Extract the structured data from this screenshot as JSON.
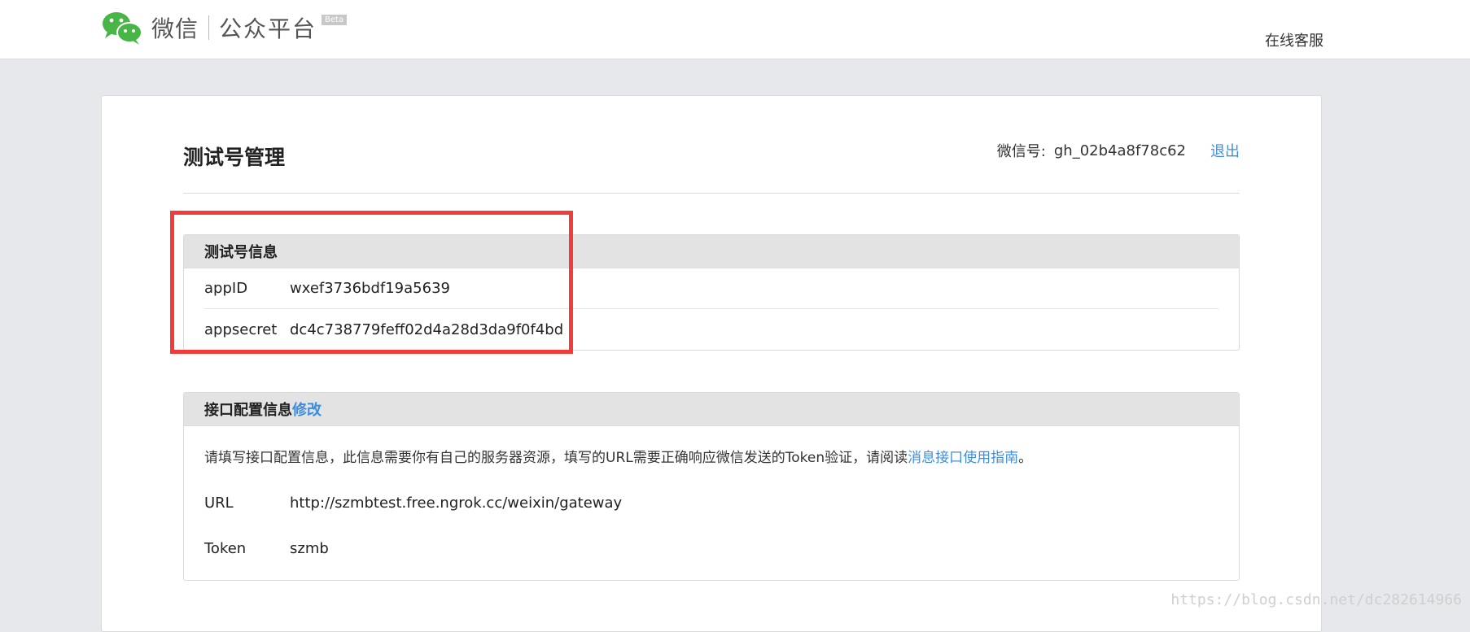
{
  "header": {
    "logo_wechat": "微信",
    "logo_platform": "公众平台",
    "logo_beta": "Beta",
    "service_link": "在线客服"
  },
  "page": {
    "title": "测试号管理",
    "account_label": "微信号:",
    "account_value": "gh_02b4a8f78c62",
    "logout": "退出"
  },
  "test_info": {
    "heading": "测试号信息",
    "rows": [
      {
        "key": "appID",
        "value": "wxef3736bdf19a5639"
      },
      {
        "key": "appsecret",
        "value": "dc4c738779feff02d4a28d3da9f0f4bd"
      }
    ]
  },
  "interface_config": {
    "heading": "接口配置信息",
    "edit_link": "修改",
    "note_prefix": "请填写接口配置信息，此信息需要你有自己的服务器资源，填写的URL需要正确响应微信发送的Token验证，请阅读",
    "note_link": "消息接口使用指南",
    "note_suffix": "。",
    "rows": [
      {
        "key": "URL",
        "value": "http://szmbtest.free.ngrok.cc/weixin/gateway"
      },
      {
        "key": "Token",
        "value": "szmb"
      }
    ]
  },
  "watermark": "https://blog.csdn.net/dc282614966",
  "colors": {
    "accent": "#3e8ee0",
    "highlight": "#f23c3c",
    "wechat_green": "#48b647"
  }
}
